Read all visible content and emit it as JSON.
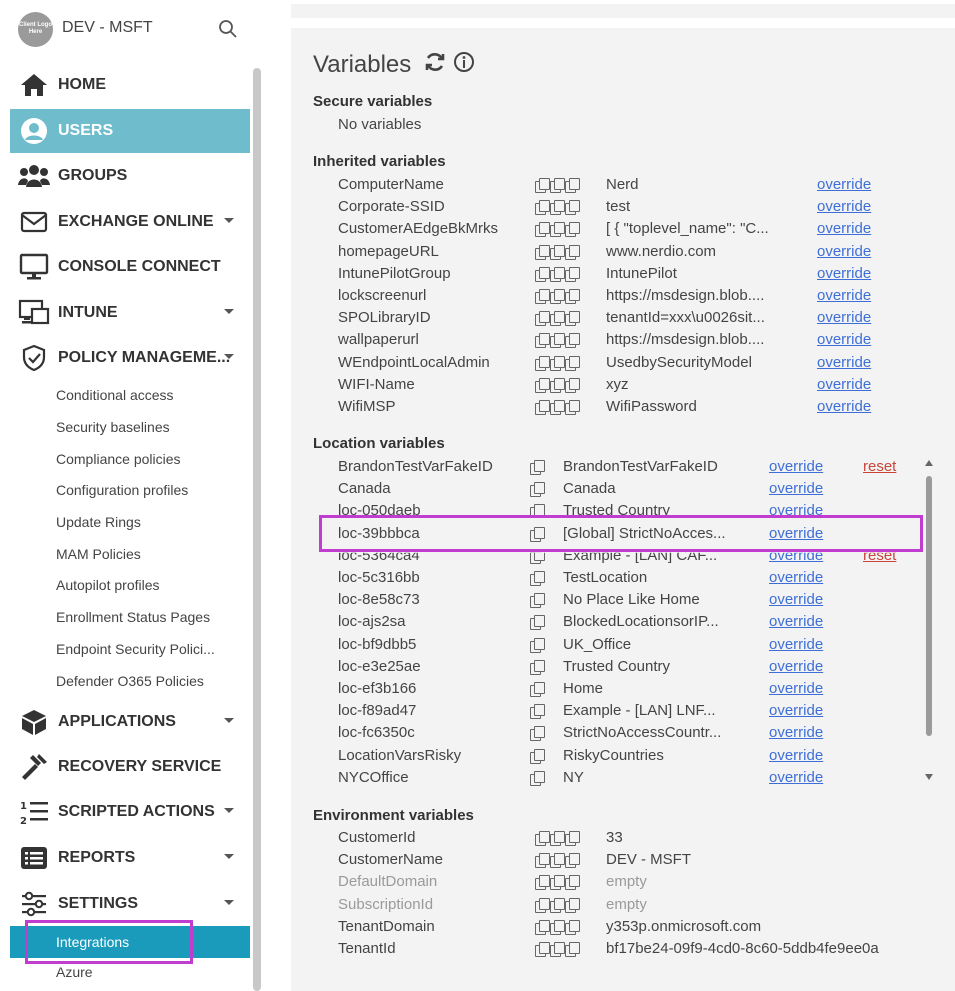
{
  "sidebar": {
    "logo_text": "Client Logo Here",
    "org_name": "DEV - MSFT",
    "nav": [
      {
        "label": "HOME",
        "icon": "home-icon"
      },
      {
        "label": "USERS",
        "icon": "user-icon"
      },
      {
        "label": "GROUPS",
        "icon": "groups-icon"
      },
      {
        "label": "EXCHANGE ONLINE",
        "icon": "mail-icon"
      },
      {
        "label": "CONSOLE CONNECT",
        "icon": "monitor-icon"
      },
      {
        "label": "INTUNE",
        "icon": "intune-icon"
      },
      {
        "label": "POLICY MANAGEME...",
        "icon": "shield-icon"
      },
      {
        "label": "APPLICATIONS",
        "icon": "box-icon"
      },
      {
        "label": "RECOVERY SERVICE",
        "icon": "hammer-icon"
      },
      {
        "label": "SCRIPTED ACTIONS",
        "icon": "list-numbered-icon"
      },
      {
        "label": "REPORTS",
        "icon": "report-icon"
      },
      {
        "label": "SETTINGS",
        "icon": "sliders-icon"
      }
    ],
    "policy_sub": [
      "Conditional access",
      "Security baselines",
      "Compliance policies",
      "Configuration profiles",
      "Update Rings",
      "MAM Policies",
      "Autopilot profiles",
      "Enrollment Status Pages",
      "Endpoint Security Polici...",
      "Defender O365 Policies"
    ],
    "settings_sub": [
      "Integrations",
      "Azure"
    ]
  },
  "variables": {
    "title": "Variables",
    "secure": {
      "heading": "Secure variables",
      "empty": "No variables"
    },
    "inherited": {
      "heading": "Inherited variables",
      "rows": [
        {
          "name": "ComputerName",
          "value": "Nerd",
          "action": "override"
        },
        {
          "name": "Corporate-SSID",
          "value": "test",
          "action": "override"
        },
        {
          "name": "CustomerAEdgeBkMrks",
          "value": "[ { \"toplevel_name\": \"C...",
          "action": "override"
        },
        {
          "name": "homepageURL",
          "value": "www.nerdio.com",
          "action": "override"
        },
        {
          "name": "IntunePilotGroup",
          "value": "IntunePilot",
          "action": "override"
        },
        {
          "name": "lockscreenurl",
          "value": "https://msdesign.blob....",
          "action": "override"
        },
        {
          "name": "SPOLibraryID",
          "value": "tenantId=xxx\\u0026sit...",
          "action": "override"
        },
        {
          "name": "wallpaperurl",
          "value": "https://msdesign.blob....",
          "action": "override"
        },
        {
          "name": "WEndpointLocalAdmin",
          "value": "UsedbySecurityModel",
          "action": "override"
        },
        {
          "name": "WIFI-Name",
          "value": "xyz",
          "action": "override"
        },
        {
          "name": "WifiMSP",
          "value": "WifiPassword",
          "action": "override"
        }
      ]
    },
    "location": {
      "heading": "Location variables",
      "rows": [
        {
          "name": "BrandonTestVarFakeID",
          "value": "BrandonTestVarFakeID",
          "action": "override",
          "reset": "reset"
        },
        {
          "name": "Canada",
          "value": "Canada",
          "action": "override",
          "reset": ""
        },
        {
          "name": "loc-050daeb",
          "value": "Trusted Country",
          "action": "override",
          "reset": ""
        },
        {
          "name": "loc-39bbbca",
          "value": "[Global] StrictNoAcces...",
          "action": "override",
          "reset": ""
        },
        {
          "name": "loc-5364ca4",
          "value": "Example - [LAN] CAF...",
          "action": "override",
          "reset": "reset"
        },
        {
          "name": "loc-5c316bb",
          "value": "TestLocation",
          "action": "override",
          "reset": ""
        },
        {
          "name": "loc-8e58c73",
          "value": "No Place Like Home",
          "action": "override",
          "reset": ""
        },
        {
          "name": "loc-ajs2sa",
          "value": "BlockedLocationsorIP...",
          "action": "override",
          "reset": ""
        },
        {
          "name": "loc-bf9dbb5",
          "value": "UK_Office",
          "action": "override",
          "reset": ""
        },
        {
          "name": "loc-e3e25ae",
          "value": "Trusted Country",
          "action": "override",
          "reset": ""
        },
        {
          "name": "loc-ef3b166",
          "value": "Home",
          "action": "override",
          "reset": ""
        },
        {
          "name": "loc-f89ad47",
          "value": "Example - [LAN] LNF...",
          "action": "override",
          "reset": ""
        },
        {
          "name": "loc-fc6350c",
          "value": "StrictNoAccessCountr...",
          "action": "override",
          "reset": ""
        },
        {
          "name": "LocationVarsRisky",
          "value": "RiskyCountries",
          "action": "override",
          "reset": ""
        },
        {
          "name": "NYCOffice",
          "value": "NY",
          "action": "override",
          "reset": ""
        }
      ]
    },
    "environment": {
      "heading": "Environment variables",
      "rows": [
        {
          "name": "CustomerId",
          "value": "33",
          "muted": false
        },
        {
          "name": "CustomerName",
          "value": "DEV - MSFT",
          "muted": false
        },
        {
          "name": "DefaultDomain",
          "value": "empty",
          "muted": true
        },
        {
          "name": "SubscriptionId",
          "value": "empty",
          "muted": true
        },
        {
          "name": "TenantDomain",
          "value": "y353p.onmicrosoft.com",
          "muted": false
        },
        {
          "name": "TenantId",
          "value": "bf17be24-09f9-4cd0-8c60-5ddb4fe9ee0a",
          "muted": false
        }
      ]
    }
  },
  "colors": {
    "accent": "#6ebccc",
    "active_sub": "#1a9bbc",
    "link": "#3e6fd9",
    "reset": "#c9443a",
    "highlight": "#c13dd0"
  }
}
